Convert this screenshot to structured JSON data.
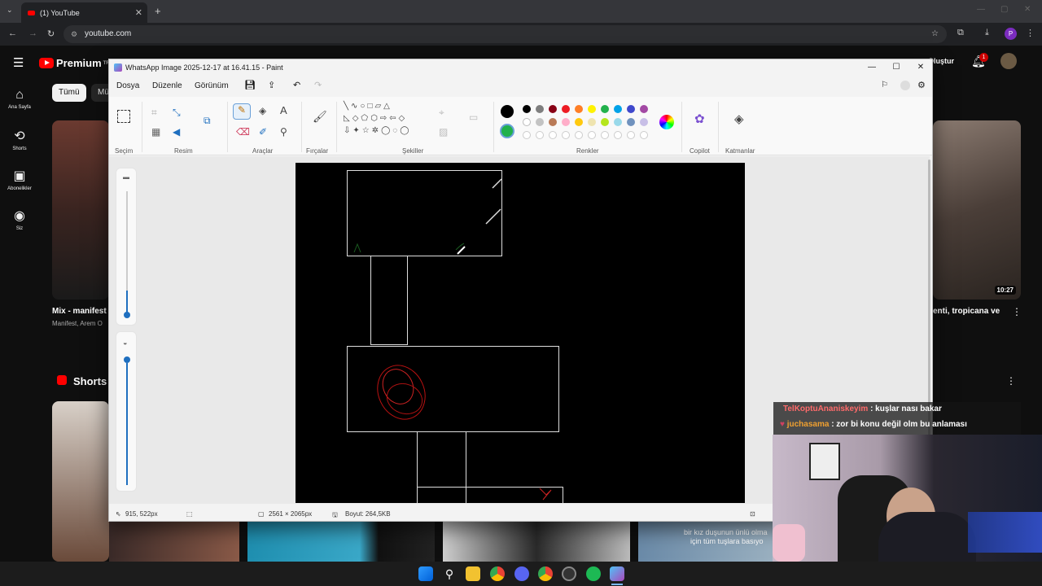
{
  "browser": {
    "tab_title": "(1) YouTube",
    "url": "youtube.com",
    "profile_initial": "P"
  },
  "youtube": {
    "logo": "Premium",
    "logo_region": "TR",
    "sidebar": [
      {
        "icon": "home-icon",
        "label": "Ana Sayfa"
      },
      {
        "icon": "shorts-icon",
        "label": "Shorts"
      },
      {
        "icon": "subscriptions-icon",
        "label": "Abonelikler"
      },
      {
        "icon": "user-icon",
        "label": "Siz"
      }
    ],
    "chips": [
      "Tümü",
      "Mü"
    ],
    "create_label": "Oluştur",
    "notifications_count": "1",
    "videos": [
      {
        "title": "Mix - manifest",
        "channel": "Manifest, Arem O"
      },
      {
        "title": "enti, tropicana ve",
        "duration": "10:27"
      }
    ],
    "shorts_label": "Shorts"
  },
  "paint": {
    "title": "WhatsApp Image 2025-12-17 at 16.41.15 - Paint",
    "menu": [
      "Dosya",
      "Düzenle",
      "Görünüm"
    ],
    "groups": [
      "Seçim",
      "Resim",
      "Araçlar",
      "Fırçalar",
      "Şekiller",
      "Renkler",
      "Copilot",
      "Katmanlar"
    ],
    "palette": [
      "#000000",
      "#7f7f7f",
      "#880015",
      "#ed1c24",
      "#ff7f27",
      "#fff200",
      "#22b14c",
      "#00a2e8",
      "#3f48cc",
      "#a349a4",
      "#ffffff",
      "#c3c3c3",
      "#b97a57",
      "#ffaec9",
      "#ffc90e",
      "#efe4b0",
      "#b5e61d",
      "#99d9ea",
      "#7092be",
      "#c8bfe7"
    ],
    "primary_color": "#000000",
    "secondary_color": "#22b14c",
    "status": {
      "cursor_pos": "915, 522px",
      "image_size": "2561 × 2065px",
      "file_size": "Boyut: 264,5KB"
    }
  },
  "chat": [
    {
      "user": "TelKoptuAnaniskeyim",
      "user_color": "#ff6b6b",
      "message": ": kuşlar nası bakar"
    },
    {
      "user": "juchasama",
      "user_color": "#f0a030",
      "message": ": zor bi konu değil olm bu anlaması"
    }
  ],
  "subtitle": [
    "bir kız duşunun ünlü olma",
    "için tüm tuşlara basıyo"
  ]
}
